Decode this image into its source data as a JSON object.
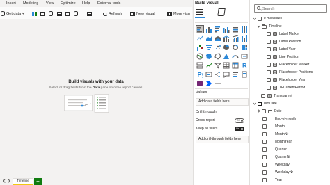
{
  "menu": [
    "Insert",
    "Modeling",
    "View",
    "Optimize",
    "Help",
    "External tools"
  ],
  "ribbon": {
    "get_data": "Get data",
    "refresh": "Refresh",
    "new_visual": "New visual",
    "more_visuals": "More visu"
  },
  "canvas": {
    "empty_title": "Build visuals with your data",
    "empty_sub_prefix": "Select or drag fields from the ",
    "empty_sub_bold": "Data",
    "empty_sub_suffix": " pane onto the report canvas."
  },
  "pages": {
    "tabs": [
      "Timeline"
    ],
    "add_label": "+"
  },
  "visualizations": {
    "title": "Build visual",
    "values_label": "Values",
    "values_placeholder": "Add data fields here",
    "drill_label": "Drill through",
    "cross_report_label": "Cross-report",
    "cross_report_state": "Off",
    "keep_filters_label": "Keep all filters",
    "keep_filters_state": "On",
    "drill_placeholder": "Add drill-through fields here"
  },
  "data_pane": {
    "search_placeholder": "Search",
    "measures_table": "# measures",
    "folder": "Timeline",
    "measures": [
      "Label Marker",
      "Label Position",
      "Label Year",
      "Line Position",
      "Placeholder Marker",
      "Placeholder Positions",
      "Placeholder Year",
      "TFCurrentPeriod"
    ],
    "transparent": "Transparent",
    "date_table": "dimDate",
    "date_hierarchy": "Date",
    "date_fields": [
      "End-of-month",
      "Month",
      "MonthNr",
      "MonthYear",
      "Quarter",
      "QuarterNr",
      "Weekday",
      "WeekdayNr",
      "Year"
    ]
  },
  "colors": {
    "accent": "#2b88d8",
    "page_tab_underline": "#f2c811",
    "add_page": "#107c10"
  }
}
